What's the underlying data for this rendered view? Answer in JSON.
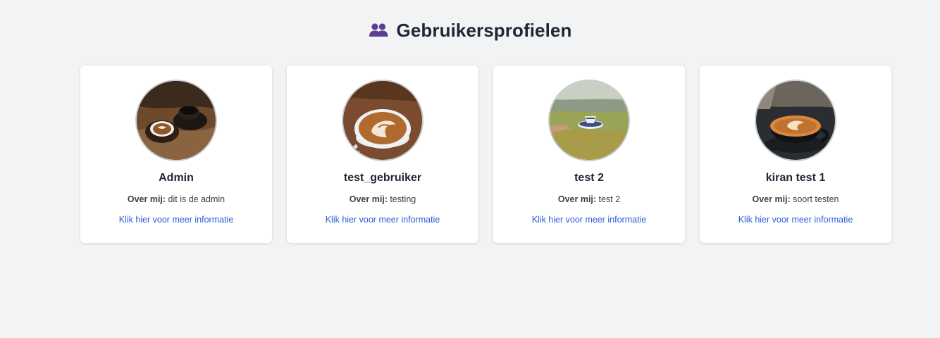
{
  "header": {
    "title": "Gebruikersprofielen",
    "icon": "users-icon",
    "icon_color": "#5b3f8c"
  },
  "profiles": [
    {
      "name": "Admin",
      "about_label": "Over mij:",
      "about_text": "dit is de admin",
      "link_text": "Klik hier voor meer informatie",
      "avatar": "coffee-cups-on-wooden-table"
    },
    {
      "name": "test_gebruiker",
      "about_label": "Over mij:",
      "about_text": "testing",
      "link_text": "Klik hier voor meer informatie",
      "avatar": "latte-art-cup"
    },
    {
      "name": "test 2",
      "about_label": "Over mij:",
      "about_text": "test 2",
      "link_text": "Klik hier voor meer informatie",
      "avatar": "hand-holding-teacup-landscape"
    },
    {
      "name": "kiran test 1",
      "about_label": "Over mij:",
      "about_text": "soort testen",
      "link_text": "Klik hier voor meer informatie",
      "avatar": "latte-art-dark-cup"
    }
  ],
  "colors": {
    "background": "#f2f3f5",
    "card": "#ffffff",
    "link": "#2a5bd7",
    "text": "#1f2733"
  }
}
